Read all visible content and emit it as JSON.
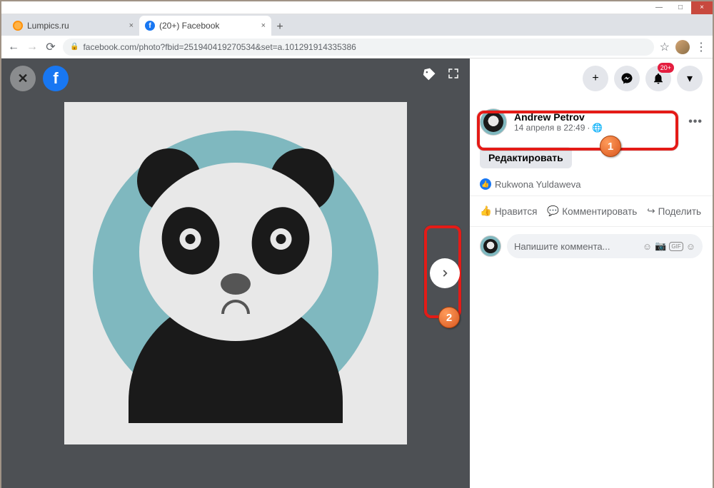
{
  "window": {
    "min": "—",
    "max": "□",
    "close": "×"
  },
  "tabs": [
    {
      "title": "Lumpics.ru"
    },
    {
      "title": "(20+) Facebook"
    }
  ],
  "url": "facebook.com/photo?fbid=251940419270534&set=a.101291914335386",
  "header": {
    "badge": "20+"
  },
  "post": {
    "author": "Andrew Petrov",
    "time": "14 апреля в 22:49",
    "dot": "·",
    "more": "•••",
    "edit_label": "Редактировать"
  },
  "reaction": {
    "name": "Rukwona Yuldaweva"
  },
  "actions": {
    "like": "Нравится",
    "comment": "Комментировать",
    "share": "Поделить"
  },
  "comment_box": {
    "placeholder": "Напишите коммента...",
    "gif": "GIF"
  },
  "annotations": {
    "n1": "1",
    "n2": "2"
  }
}
